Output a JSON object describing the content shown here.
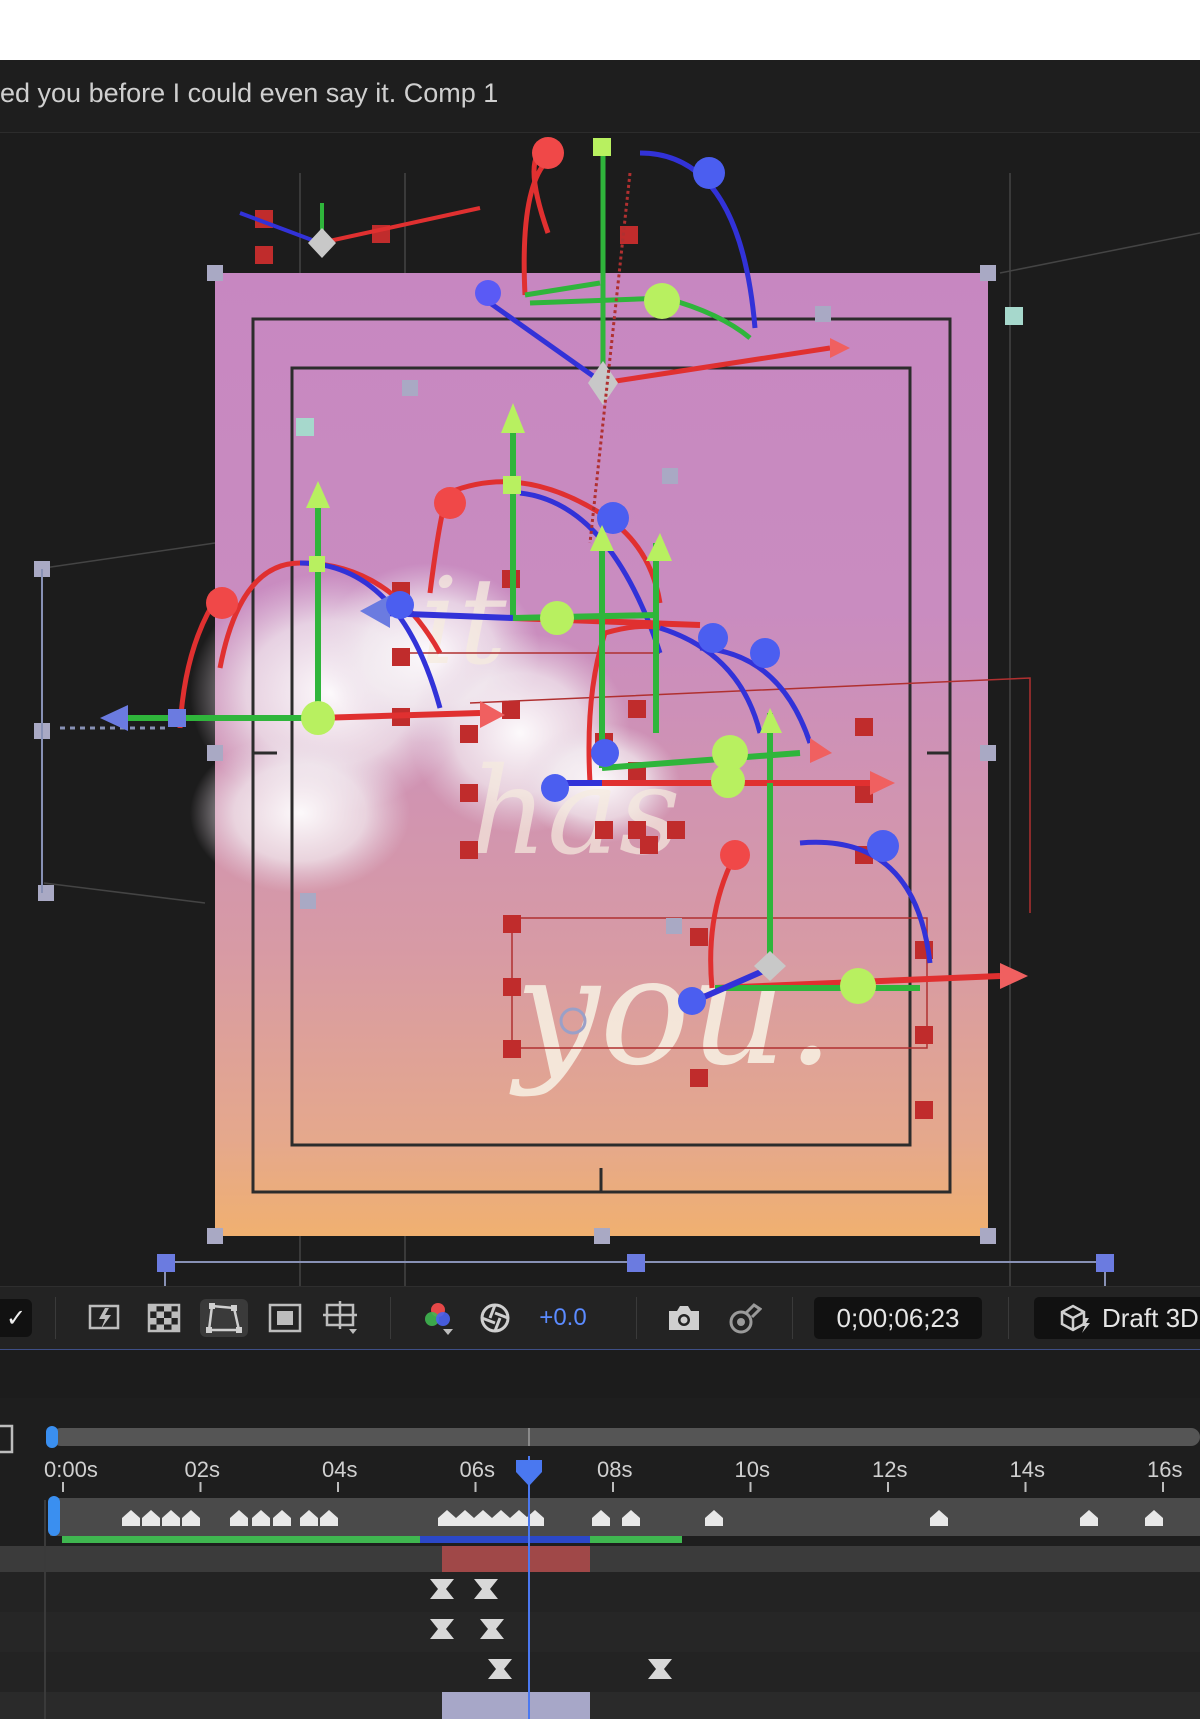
{
  "composition": {
    "title": "ed you before I could even say it. Comp 1"
  },
  "viewer": {
    "text_layers": [
      "it",
      "has",
      "you."
    ]
  },
  "toolbar": {
    "check_glyph": "✓",
    "exposure": "+0.0",
    "timecode": "0;00;06;23",
    "renderer_label": "Draft 3D",
    "icons": [
      "fast-previews-icon",
      "transparency-grid-icon",
      "mask-path-visibility-icon",
      "region-of-interest-icon",
      "grid-guides-icon",
      "rgb-channels-icon",
      "exposure-reset-icon",
      "snapshot-camera-icon",
      "show-snapshot-icon",
      "draft-3d-icon"
    ]
  },
  "timeline": {
    "ruler_labels": [
      "0:00s",
      "02s",
      "04s",
      "06s",
      "08s",
      "10s",
      "12s",
      "14s",
      "16s"
    ],
    "playhead_time": "06s+23f"
  }
}
